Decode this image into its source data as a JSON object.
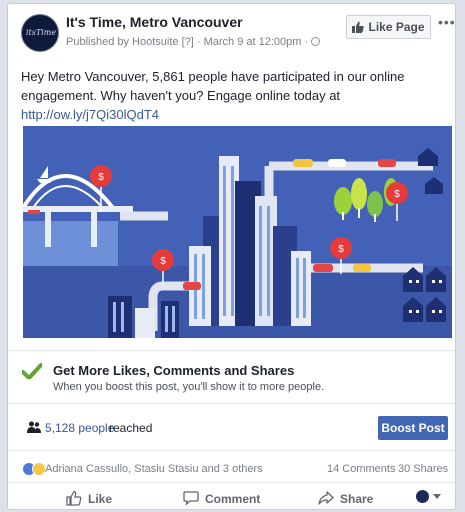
{
  "post": {
    "page_name": "It's Time, Metro Vancouver",
    "published_by": "Published by Hootsuite [?] · March 9 at 12:00pm ·",
    "like_page_label": "Like Page",
    "more_label": "•••",
    "avatar_text": "itsTime",
    "text_line1": "Hey Metro Vancouver, 5,861 people have participated in our online",
    "text_line2": "engagement. Why haven't you? Engage online today at",
    "link": "http://ow.ly/j7Qi30lQdT4"
  },
  "illustration": {
    "sign_label": "$",
    "colors": {
      "sky": "#4361b6",
      "road": "#dfe4ee",
      "pin": "#e53b3b",
      "tree": "#9bd13a",
      "water": "#6d90d8"
    }
  },
  "boost_promo": {
    "title": "Get More Likes, Comments and Shares",
    "subtitle": "When you boost this post, you'll show it to more people."
  },
  "reach": {
    "count": "5,128 people",
    "label": "reached",
    "boost_button": "Boost Post"
  },
  "reactions": {
    "names": "Adriana Cassullo, Stasiu Stasiu and 3 others",
    "comments": "14 Comments",
    "shares": "30 Shares"
  },
  "actions": {
    "like": "Like",
    "comment": "Comment",
    "share": "Share"
  },
  "colors": {
    "link": "#385898",
    "boost": "#4267b2",
    "check": "#5fa52b"
  }
}
